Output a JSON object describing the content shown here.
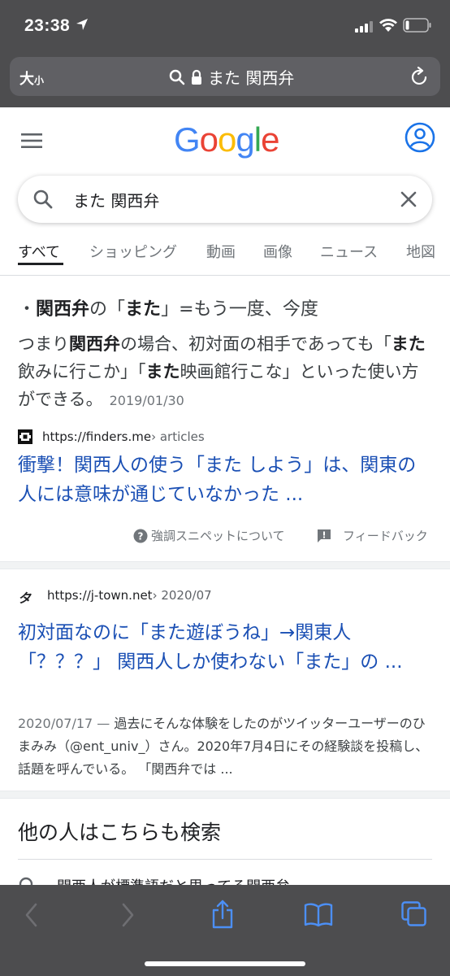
{
  "status_bar": {
    "time": "23:38"
  },
  "address_bar": {
    "text_size_label_large": "大",
    "text_size_label_small": "小",
    "query": "また 関西弁"
  },
  "google_header": {
    "logo": "Google",
    "logo_colors": [
      "#4285F4",
      "#EA4335",
      "#FBBC05",
      "#4285F4",
      "#34A853",
      "#EA4335"
    ]
  },
  "search": {
    "value": "また 関西弁"
  },
  "tabs": [
    {
      "label": "すべて",
      "active": true
    },
    {
      "label": "ショッピング",
      "active": false
    },
    {
      "label": "動画",
      "active": false
    },
    {
      "label": "画像",
      "active": false
    },
    {
      "label": "ニュース",
      "active": false
    },
    {
      "label": "地図",
      "active": false
    }
  ],
  "featured_snippet": {
    "title_prefix": "・",
    "title_b1": "関西弁",
    "title_mid": "の「",
    "title_b2": "また",
    "title_suffix": "」=もう一度、今度",
    "body_p1": "つまり",
    "body_b1": "関西弁",
    "body_p2": "の場合、初対面の相手であっても「",
    "body_b2": "また",
    "body_p3": "飲みに行こか」「",
    "body_b3": "また",
    "body_p4": "映画館行こな」といった使い方ができる。",
    "date": "2019/01/30",
    "source_url": "https://finders.me",
    "source_crumb": " › articles",
    "link_title": "衝撃！関西人の使う「また しよう」は、関東の人には意味が通じていなかった ...",
    "about_label": "強調スニペットについて",
    "feedback_label": "フィードバック"
  },
  "result2": {
    "favicon_letter": "タ",
    "source_url": "https://j-town.net",
    "source_crumb": " › 2020/07",
    "link_title": "初対面なのに「また遊ぼうね」→関東人「？？？」 関西人しか使わない「また」の ...",
    "date": "2020/07/17 — ",
    "snippet": "過去にそんな体験をしたのがツイッターユーザーのひまみみ（@ent_univ_）さん。2020年7月4日にその経験談を投稿し、話題を呼んでいる。 「関西弁では ..."
  },
  "people_also_search": {
    "title": "他の人はこちらも検索",
    "first_item": "関西人が標準語だと思ってる関西弁"
  }
}
